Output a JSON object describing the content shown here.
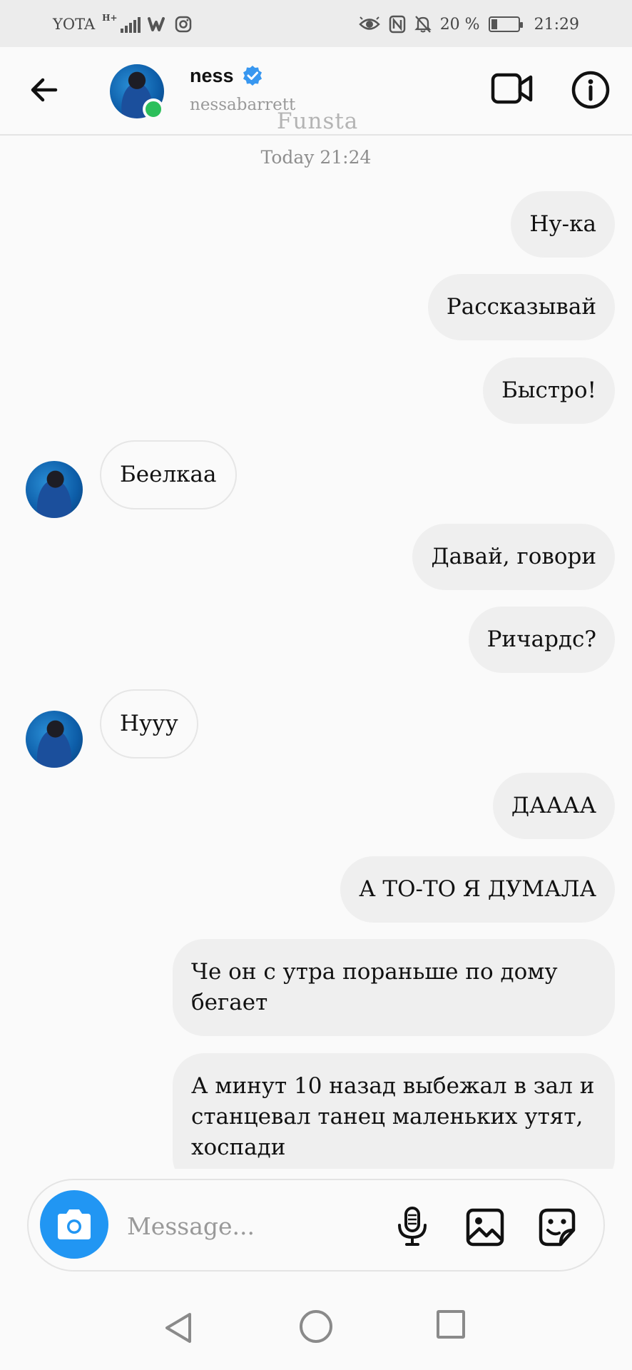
{
  "status_bar": {
    "carrier": "YOTA",
    "network": "H+",
    "battery": "20 %",
    "battery_level": 0.2,
    "time": "21:29",
    "icons": [
      "signal-icon",
      "wattpad-icon",
      "instagram-icon",
      "eye-icon",
      "nfc-icon",
      "bell-off-icon",
      "battery-icon"
    ]
  },
  "header": {
    "name": "ness",
    "username": "nessabarrett",
    "watermark": "Funsta",
    "online_color": "#2cbf5a",
    "verified_color": "#3897f0"
  },
  "chat": {
    "timestamp": "Today 21:24",
    "messages": [
      {
        "dir": "out",
        "text": "Ну-ка"
      },
      {
        "dir": "out",
        "text": "Рассказывай"
      },
      {
        "dir": "out",
        "text": "Быстро!"
      },
      {
        "dir": "in",
        "text": "Беелкаа"
      },
      {
        "dir": "out",
        "text": "Давай, говори"
      },
      {
        "dir": "out",
        "text": "Ричардс?"
      },
      {
        "dir": "in",
        "text": "Нууу"
      },
      {
        "dir": "out",
        "text": "ДАААА"
      },
      {
        "dir": "out",
        "text": "А ТО-ТО Я ДУМАЛА"
      },
      {
        "dir": "out",
        "text": "Че он с утра пораньше по дому бегает"
      },
      {
        "dir": "out",
        "text": "А минут 10 назад выбежал в зал и станцевал танец маленьких утят, хоспади"
      }
    ]
  },
  "composer": {
    "placeholder": "Message...",
    "accent": "#2196f3"
  }
}
